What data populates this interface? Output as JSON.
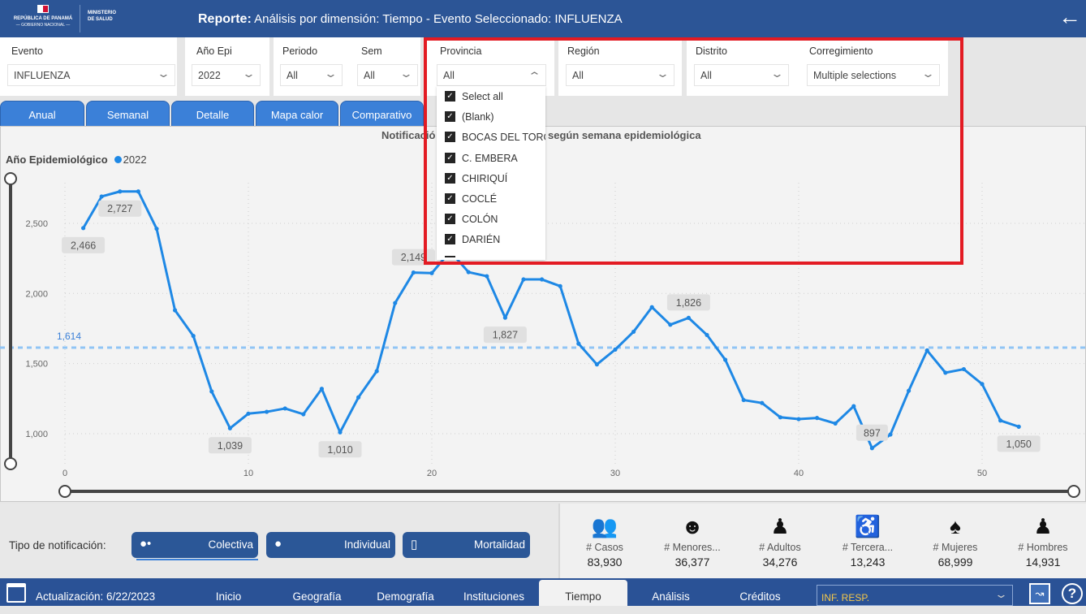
{
  "header": {
    "logo_text": "REPÚBLICA DE PANAMÁ — GOBIERNO NACIONAL —",
    "ministry": "MINISTERIO DE SALUD",
    "title_bold": "Reporte:",
    "title_rest": " Análisis por dimensión: Tiempo - Evento Seleccionado: INFLUENZA",
    "back_icon": "arrow-left-icon"
  },
  "filters": {
    "evento": {
      "label": "Evento",
      "value": "INFLUENZA"
    },
    "anio": {
      "label": "Año Epi",
      "value": "2022"
    },
    "periodo": {
      "label": "Periodo",
      "value": "All"
    },
    "sem": {
      "label": "Sem",
      "value": "All"
    },
    "provincia": {
      "label": "Provincia",
      "value": "All",
      "options": [
        "Select all",
        "(Blank)",
        "BOCAS DEL TORO",
        "C. EMBERA",
        "CHIRIQUÍ",
        "COCLÉ",
        "COLÓN",
        "DARIÉN"
      ]
    },
    "region": {
      "label": "Región",
      "value": "All"
    },
    "distrito": {
      "label": "Distrito",
      "value": "All"
    },
    "corregimiento": {
      "label": "Corregimiento",
      "value": "Multiple selections"
    }
  },
  "tabs": [
    "Anual",
    "Semanal",
    "Detalle",
    "Mapa calor",
    "Comparativo"
  ],
  "highlight_color": "#e31b23",
  "chart_data": {
    "type": "line",
    "title_visible_left": "Notificació",
    "title_visible_right": "según semana epidemiológica",
    "legend_title": "Año Epidemiológico",
    "series": [
      {
        "name": "2022",
        "color": "#1e88e5",
        "x": [
          1,
          2,
          3,
          4,
          5,
          6,
          7,
          8,
          9,
          10,
          11,
          12,
          13,
          14,
          15,
          16,
          17,
          18,
          19,
          20,
          21,
          22,
          23,
          24,
          25,
          26,
          27,
          28,
          29,
          30,
          31,
          32,
          33,
          34,
          35,
          36,
          37,
          38,
          39,
          40,
          41,
          42,
          43,
          44,
          45,
          46,
          47,
          48,
          49,
          50,
          51,
          52
        ],
        "values": [
          2466,
          2691,
          2727,
          2727,
          2461,
          1880,
          1697,
          1301,
          1039,
          1143,
          1156,
          1180,
          1139,
          1320,
          1010,
          1259,
          1446,
          1932,
          2149,
          2145,
          2300,
          2152,
          2123,
          1827,
          2100,
          2100,
          2052,
          1642,
          1494,
          1600,
          1727,
          1902,
          1777,
          1826,
          1704,
          1527,
          1240,
          1219,
          1117,
          1104,
          1112,
          1073,
          1196,
          897,
          994,
          1306,
          1594,
          1435,
          1460,
          1354,
          1094,
          1050
        ]
      }
    ],
    "data_labels": [
      {
        "x": 1,
        "text": "2,466",
        "pos": "below"
      },
      {
        "x": 3,
        "text": "2,727",
        "pos": "below"
      },
      {
        "x": 9,
        "text": "1,039",
        "pos": "below"
      },
      {
        "x": 15,
        "text": "1,010",
        "pos": "below"
      },
      {
        "x": 19,
        "text": "2,149",
        "pos": "above"
      },
      {
        "x": 24,
        "text": "1,827",
        "pos": "below"
      },
      {
        "x": 34,
        "text": "1,826",
        "pos": "above"
      },
      {
        "x": 44,
        "text": "897",
        "pos": "above"
      },
      {
        "x": 52,
        "text": "1,050",
        "pos": "below"
      }
    ],
    "average": {
      "value": 1614,
      "label": "1,614",
      "color": "#90c4f5"
    },
    "x_ticks": [
      0,
      10,
      20,
      30,
      40,
      50
    ],
    "y_ticks": [
      1000,
      1500,
      2000,
      2500
    ],
    "y_tick_labels": [
      "1,000",
      "1,500",
      "2,000",
      "2,500"
    ],
    "xlim": [
      0,
      55.5
    ],
    "ylim": [
      790,
      2850
    ],
    "grid": true
  },
  "notification": {
    "label": "Tipo de notificación:",
    "buttons": [
      {
        "label": "Colectiva",
        "icon": "group-icon",
        "selected": true
      },
      {
        "label": "Individual",
        "icon": "person-icon"
      },
      {
        "label": "Mortalidad",
        "icon": "tombstone-icon"
      }
    ]
  },
  "stats": [
    {
      "label": "# Casos",
      "value": "83,930",
      "icon": "people-icon"
    },
    {
      "label": "# Menores...",
      "value": "36,377",
      "icon": "child-icon"
    },
    {
      "label": "# Adultos",
      "value": "34,276",
      "icon": "adult-icon"
    },
    {
      "label": "# Tercera...",
      "value": "13,243",
      "icon": "elderly-icon"
    },
    {
      "label": "# Mujeres",
      "value": "68,999",
      "icon": "woman-icon"
    },
    {
      "label": "# Hombres",
      "value": "14,931",
      "icon": "man-icon"
    }
  ],
  "footer": {
    "update": "Actualización: 6/22/2023",
    "nav": [
      "Inicio",
      "Geografía",
      "Demografía",
      "Instituciones",
      "Tiempo",
      "Análisis",
      "Créditos"
    ],
    "active": "Tiempo",
    "resp_select": "INF. RESP."
  }
}
